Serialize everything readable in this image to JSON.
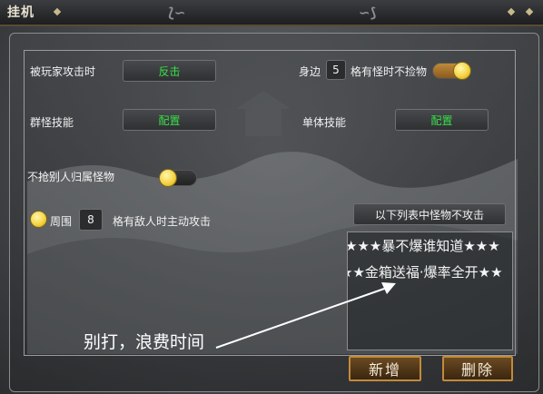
{
  "window": {
    "title": "挂机"
  },
  "pk": {
    "label": "被玩家攻击时",
    "button": "反击"
  },
  "nearby": {
    "prefix": "身边",
    "count": "5",
    "suffix": "格有怪时不捡物",
    "toggle_on": true
  },
  "group_skill": {
    "label": "群怪技能",
    "button": "配置"
  },
  "single_skill": {
    "label": "单体技能",
    "button": "配置"
  },
  "no_steal": {
    "label": "不抢别人归属怪物",
    "toggle_on": false
  },
  "around": {
    "prefix": "周围",
    "count": "8",
    "suffix": "格有敌人时主动攻击",
    "selected": true
  },
  "monster_list": {
    "header": "以下列表中怪物不攻击",
    "items": [
      "★★★暴不爆谁知道★★★",
      "★★金箱送福·爆率全开★★"
    ]
  },
  "buttons": {
    "add": "新增",
    "delete": "删除"
  },
  "annotation": {
    "text": "别打，浪费时间"
  },
  "colors": {
    "green_text": "#38e048",
    "gold_border": "#c28a3a",
    "toggle_on": "#b07a2e"
  }
}
